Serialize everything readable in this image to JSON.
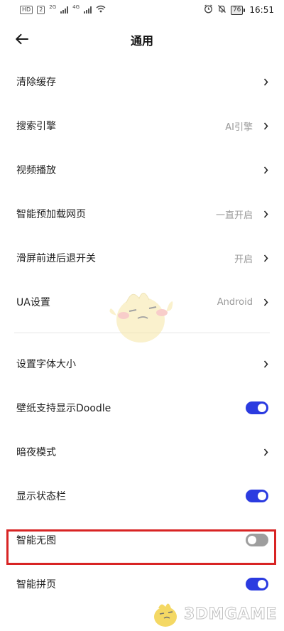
{
  "status_bar": {
    "hd_badge": "HD",
    "sim_badge": "2",
    "net1": "2G",
    "net2": "4G",
    "battery": "76",
    "time": "16:51"
  },
  "header": {
    "title": "通用"
  },
  "rows": [
    {
      "label": "清除缓存"
    },
    {
      "label": "搜索引擎",
      "value": "AI引擎"
    },
    {
      "label": "视频播放"
    },
    {
      "label": "智能预加载网页",
      "value": "一直开启"
    },
    {
      "label": "滑屏前进后退开关",
      "value": "开启"
    },
    {
      "label": "UA设置",
      "value": "Android"
    }
  ],
  "rows2": [
    {
      "label": "设置字体大小"
    },
    {
      "label": "壁纸支持显示Doodle",
      "toggle": "on"
    },
    {
      "label": "暗夜模式"
    },
    {
      "label": "显示状态栏",
      "toggle": "on"
    },
    {
      "label": "智能无图",
      "toggle": "off"
    },
    {
      "label": "智能拼页",
      "toggle": "on"
    }
  ],
  "watermark": {
    "text": "3DMGAME"
  },
  "colors": {
    "toggle_on": "#2b3be0",
    "toggle_off": "#9e9e9e",
    "highlight": "#d82424"
  }
}
